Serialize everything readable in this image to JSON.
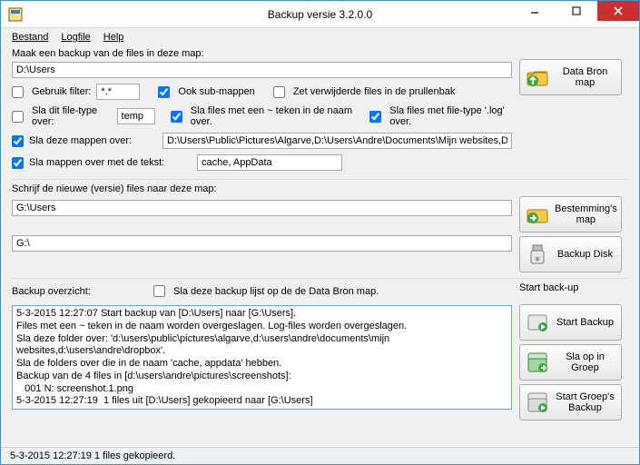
{
  "window": {
    "title": "Backup versie 3.2.0.0"
  },
  "menu": {
    "bestand": "Bestand",
    "logfile": "Logfile",
    "help": "Help"
  },
  "source": {
    "heading": "Maak een backup van de files in deze map:",
    "path": "D:\\Users",
    "browse_btn": "Data Bron map",
    "use_filter_label": "Gebruik filter:",
    "filter_value": "*.*",
    "include_subfolders_label": "Ook sub-mappen",
    "recycle_label": "Zet verwijderde files in de prullenbak",
    "skip_filetype_label": "Sla dit file-type over:",
    "skip_filetype_value": "temp",
    "skip_tilde_label": "Sla files met een ~ teken in de naam over.",
    "skip_log_label": "Sla files met file-type '.log' over.",
    "skip_folders_label": "Sla deze mappen over:",
    "skip_folders_value": "D:\\Users\\Public\\Pictures\\Algarve,D:\\Users\\Andre\\Documents\\Mijn websites,D:\\Users\\Andre\\Dropbox",
    "skip_name_contains_label": "Sla mappen over met de tekst:",
    "skip_name_contains_value": "cache, AppData"
  },
  "dest": {
    "heading": "Schrijf de nieuwe (versie) files naar deze map:",
    "path": "G:\\Users",
    "browse_btn": "Bestemming's map",
    "disk_path": "G:\\",
    "disk_btn": "Backup Disk"
  },
  "overview": {
    "heading": "Backup overzicht:",
    "save_list_label": "Sla deze backup lijst op de de Data Bron map.",
    "start_heading": "Start back-up",
    "start_btn": "Start Backup",
    "save_group_btn": "Sla op in Groep",
    "start_group_btn": "Start Groep's Backup",
    "log": "5-3-2015 12:27:07 Start backup van [D:\\Users] naar [G:\\Users].\nFiles met een ~ teken in de naam worden overgeslagen. Log-files worden overgeslagen.\nSla deze folder over: 'd:\\users\\public\\pictures\\algarve,d:\\users\\andre\\documents\\mijn websites,d:\\users\\andre\\dropbox'.\nSla de folders over die in de naam 'cache, appdata' hebben.\nBackup van de 4 files in [d:\\users\\andre\\pictures\\screenshots]:\n   001 N: screenshot.1.png\n5-3-2015 12:27:19  1 files uit [D:\\Users] gekopieerd naar [G:\\Users]"
  },
  "status": "5-3-2015 12:27:19  1 files gekopieerd.",
  "checked": {
    "use_filter": false,
    "include_subfolders": true,
    "recycle": false,
    "skip_filetype": false,
    "skip_tilde": true,
    "skip_log": true,
    "skip_folders": true,
    "skip_name_contains": true,
    "save_list": false
  }
}
